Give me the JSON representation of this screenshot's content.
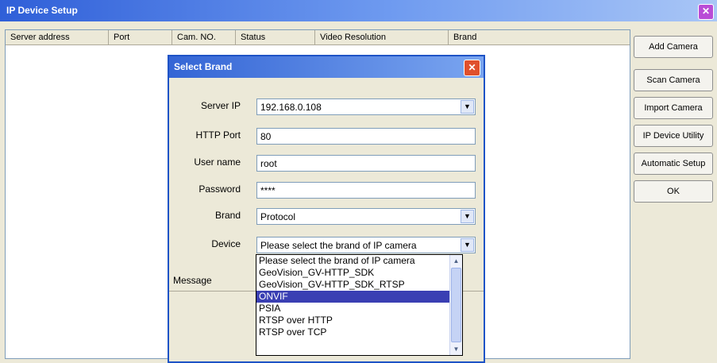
{
  "window": {
    "title": "IP Device Setup",
    "close_label": "✕"
  },
  "table": {
    "columns": [
      "Server address",
      "Port",
      "Cam. NO.",
      "Status",
      "Video Resolution",
      "Brand"
    ]
  },
  "buttons": [
    "Add Camera",
    "Scan Camera",
    "Import Camera",
    "IP Device Utility",
    "Automatic Setup",
    "OK"
  ],
  "dialog": {
    "title": "Select Brand",
    "close_label": "✕",
    "fields": {
      "server_ip": {
        "label": "Server IP",
        "value": "192.168.0.108"
      },
      "http_port": {
        "label": "HTTP Port",
        "value": "80"
      },
      "user_name": {
        "label": "User name",
        "value": "root"
      },
      "password": {
        "label": "Password",
        "value": "****"
      },
      "brand": {
        "label": "Brand",
        "value": "Protocol"
      },
      "device": {
        "label": "Device",
        "value": "Please select the brand of IP camera"
      }
    },
    "message_label": "Message",
    "dropdown_arrow": "▼"
  },
  "device_list": {
    "items": [
      "Please select the brand of IP camera",
      "GeoVision_GV-HTTP_SDK",
      "GeoVision_GV-HTTP_SDK_RTSP",
      "ONVIF",
      "PSIA",
      "RTSP over HTTP",
      "RTSP over TCP"
    ],
    "selected": "ONVIF",
    "scroll_up": "▲",
    "scroll_down": "▼"
  }
}
